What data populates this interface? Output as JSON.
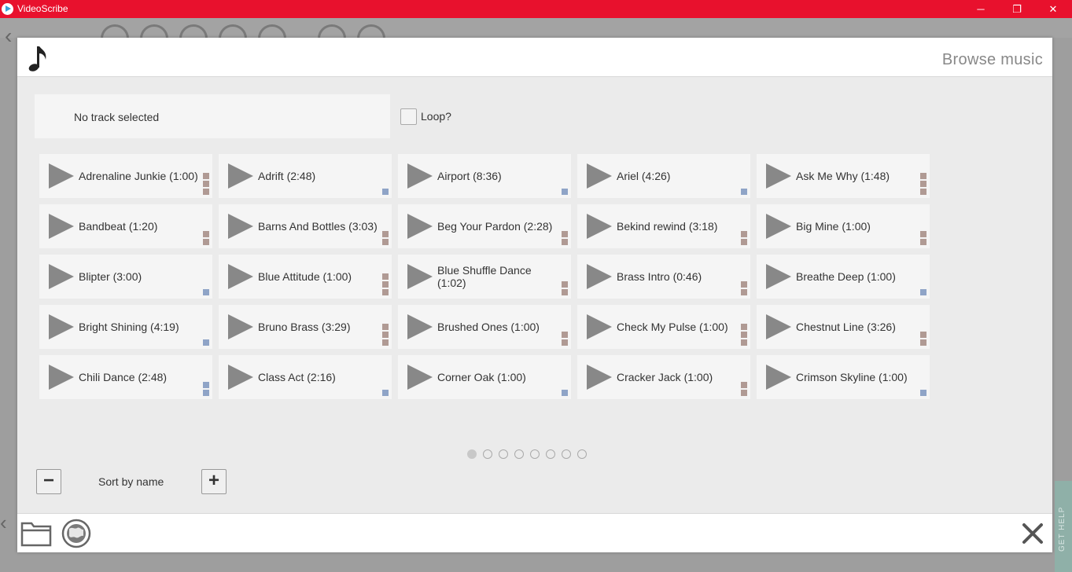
{
  "window": {
    "title": "VideoScribe",
    "minimize_icon": "─",
    "maximize_icon": "❐",
    "close_icon": "✕"
  },
  "dialog": {
    "title": "Browse music",
    "track_display": "No track selected",
    "loop_label": "Loop?",
    "sort_label": "Sort by name",
    "zoom_out_label": "−",
    "zoom_in_label": "+"
  },
  "tracks": [
    {
      "name": "Adrenaline Junkie (1:00)",
      "marks": 3,
      "mark_color": "#b09a94"
    },
    {
      "name": "Adrift (2:48)",
      "marks": 1,
      "mark_color": "#8fa4c7"
    },
    {
      "name": "Airport (8:36)",
      "marks": 1,
      "mark_color": "#8fa4c7"
    },
    {
      "name": "Ariel (4:26)",
      "marks": 1,
      "mark_color": "#8fa4c7"
    },
    {
      "name": "Ask Me Why (1:48)",
      "marks": 3,
      "mark_color": "#b09a94"
    },
    {
      "name": "Bandbeat (1:20)",
      "marks": 2,
      "mark_color": "#b09a94"
    },
    {
      "name": "Barns And Bottles (3:03)",
      "marks": 2,
      "mark_color": "#b09a94"
    },
    {
      "name": "Beg Your Pardon (2:28)",
      "marks": 2,
      "mark_color": "#b09a94"
    },
    {
      "name": "Bekind rewind (3:18)",
      "marks": 2,
      "mark_color": "#b09a94"
    },
    {
      "name": "Big Mine (1:00)",
      "marks": 2,
      "mark_color": "#b09a94"
    },
    {
      "name": "Blipter (3:00)",
      "marks": 1,
      "mark_color": "#8fa4c7"
    },
    {
      "name": "Blue Attitude (1:00)",
      "marks": 3,
      "mark_color": "#b09a94"
    },
    {
      "name": "Blue Shuffle Dance (1:02)",
      "marks": 2,
      "mark_color": "#b09a94"
    },
    {
      "name": "Brass Intro (0:46)",
      "marks": 2,
      "mark_color": "#b09a94"
    },
    {
      "name": "Breathe Deep (1:00)",
      "marks": 1,
      "mark_color": "#8fa4c7"
    },
    {
      "name": "Bright Shining (4:19)",
      "marks": 1,
      "mark_color": "#8fa4c7"
    },
    {
      "name": "Bruno Brass (3:29)",
      "marks": 3,
      "mark_color": "#b09a94"
    },
    {
      "name": "Brushed Ones (1:00)",
      "marks": 2,
      "mark_color": "#b09a94"
    },
    {
      "name": "Check My Pulse (1:00)",
      "marks": 3,
      "mark_color": "#b09a94"
    },
    {
      "name": "Chestnut Line (3:26)",
      "marks": 2,
      "mark_color": "#b09a94"
    },
    {
      "name": "Chili Dance (2:48)",
      "marks": 2,
      "mark_color": "#8fa4c7"
    },
    {
      "name": "Class Act (2:16)",
      "marks": 1,
      "mark_color": "#8fa4c7"
    },
    {
      "name": "Corner Oak (1:00)",
      "marks": 1,
      "mark_color": "#8fa4c7"
    },
    {
      "name": "Cracker Jack (1:00)",
      "marks": 2,
      "mark_color": "#b09a94"
    },
    {
      "name": "Crimson Skyline (1:00)",
      "marks": 1,
      "mark_color": "#8fa4c7"
    }
  ],
  "pager": {
    "pages": 8,
    "current": 1
  },
  "footer": {
    "folder_icon": "folder-icon",
    "globe_icon": "globe-icon",
    "close_icon": "close-icon"
  },
  "sidebar_tab": {
    "label": "GET HELP"
  }
}
